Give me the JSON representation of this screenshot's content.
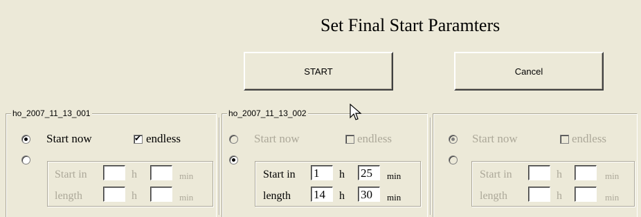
{
  "window": {
    "title": "Set Final Start Paramters"
  },
  "buttons": {
    "start_label": "START",
    "cancel_label": "Cancel"
  },
  "groups": [
    {
      "name": "ho_2007_11_13_001",
      "enabled": true,
      "start_now_label": "Start now",
      "endless_label": "endless",
      "endless_checked": true,
      "mode": "start_now",
      "start_in_label": "Start in",
      "length_label": "length",
      "h_label": "h",
      "min_label": "min",
      "start_in_h": "",
      "start_in_min": "",
      "length_h": "",
      "length_min": ""
    },
    {
      "name": "ho_2007_11_13_002",
      "enabled": false,
      "start_now_label": "Start now",
      "endless_label": "endless",
      "endless_checked": false,
      "mode": "start_in",
      "start_in_label": "Start in",
      "length_label": "length",
      "h_label": "h",
      "min_label": "min",
      "start_in_h": "1",
      "start_in_min": "25",
      "length_h": "14",
      "length_min": "30"
    },
    {
      "name": "",
      "enabled": false,
      "start_now_label": "Start now",
      "endless_label": "endless",
      "endless_checked": false,
      "mode": "start_now",
      "start_in_label": "Start in",
      "length_label": "length",
      "h_label": "h",
      "min_label": "min",
      "start_in_h": "",
      "start_in_min": "",
      "length_h": "",
      "length_min": ""
    }
  ]
}
